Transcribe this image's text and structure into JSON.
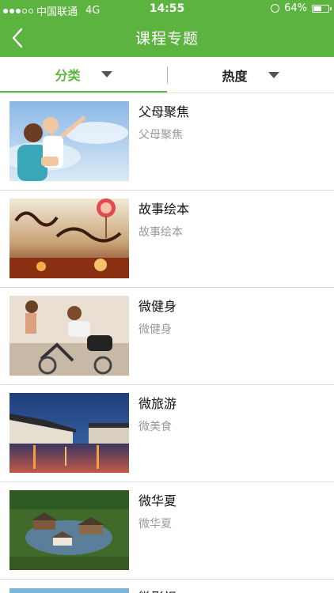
{
  "status_bar": {
    "carrier": "中国联通",
    "network": "4G",
    "time": "14:55",
    "battery": "64%",
    "battery_level": 0.64
  },
  "nav": {
    "title": "课程专题",
    "back_icon": "chevron-left-icon"
  },
  "filters": {
    "category_label": "分类",
    "popularity_label": "热度"
  },
  "courses": [
    {
      "title": "父母聚焦",
      "subtitle": "父母聚焦",
      "image": "family-photo"
    },
    {
      "title": "故事绘本",
      "subtitle": "故事绘本",
      "image": "storybook-cover"
    },
    {
      "title": "微健身",
      "subtitle": "微健身",
      "image": "fitness-photo"
    },
    {
      "title": "微旅游",
      "subtitle": "微美食",
      "image": "water-town-photo"
    },
    {
      "title": "微华夏",
      "subtitle": "微华夏",
      "image": "garden-photo"
    }
  ],
  "partial_item": {
    "title": "微影视"
  },
  "colors": {
    "accent": "#5cb340",
    "subtitle": "#999999",
    "divider": "#dcdcdc"
  }
}
